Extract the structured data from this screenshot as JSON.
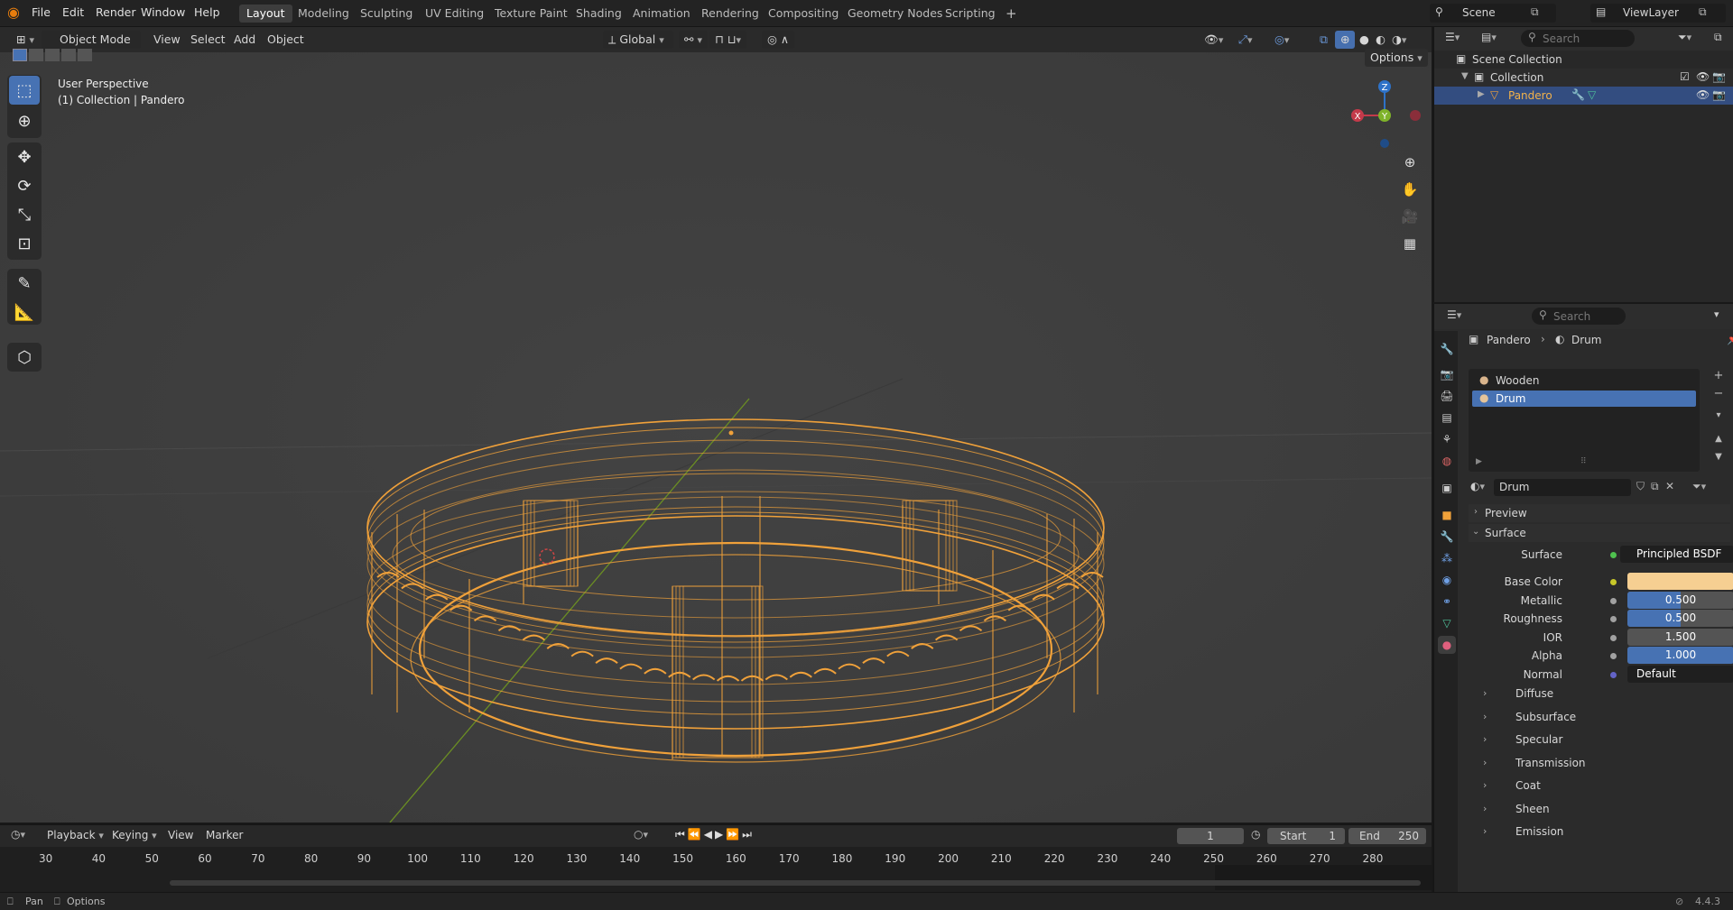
{
  "app": {
    "name": "Blender",
    "version": "4.4.3"
  },
  "menus": [
    "File",
    "Edit",
    "Render",
    "Window",
    "Help"
  ],
  "workspaces": [
    "Layout",
    "Modeling",
    "Sculpting",
    "UV Editing",
    "Texture Paint",
    "Shading",
    "Animation",
    "Rendering",
    "Compositing",
    "Geometry Nodes",
    "Scripting"
  ],
  "active_workspace": "Layout",
  "add_workspace": "+",
  "scene": {
    "label": "Scene",
    "viewlayer": "ViewLayer"
  },
  "viewport": {
    "mode": "Object Mode",
    "menus": [
      "View",
      "Select",
      "Add",
      "Object"
    ],
    "transform_orientation": "Global",
    "options_label": "Options",
    "info_line1": "User Perspective",
    "info_line2": "(1) Collection | Pandero",
    "gizmo": {
      "x": "X",
      "y": "Y",
      "z": "Z"
    },
    "wire_color": "#f0a13a"
  },
  "outliner": {
    "search_placeholder": "Search",
    "scene_collection": "Scene Collection",
    "collection": "Collection",
    "object": "Pandero"
  },
  "properties": {
    "search_placeholder": "Search",
    "breadcrumb_object": "Pandero",
    "breadcrumb_material": "Drum",
    "slots": [
      "Wooden",
      "Drum"
    ],
    "active_slot": "Drum",
    "material_name": "Drum",
    "panels": {
      "preview": "Preview",
      "surface": "Surface"
    },
    "surface_label": "Surface",
    "surface_shader": "Principled BSDF",
    "fields": [
      {
        "label": "Base Color",
        "value": "",
        "kind": "color",
        "color": "#f6cf92"
      },
      {
        "label": "Metallic",
        "value": "0.500",
        "kind": "slider",
        "fill": 0.5
      },
      {
        "label": "Roughness",
        "value": "0.500",
        "kind": "slider",
        "fill": 0.5
      },
      {
        "label": "IOR",
        "value": "1.500",
        "kind": "slider",
        "fill": 0
      },
      {
        "label": "Alpha",
        "value": "1.000",
        "kind": "slider",
        "fill": 1.0
      },
      {
        "label": "Normal",
        "value": "Default",
        "kind": "link"
      }
    ],
    "subpanels": [
      "Diffuse",
      "Subsurface",
      "Specular",
      "Transmission",
      "Coat",
      "Sheen",
      "Emission"
    ]
  },
  "timeline": {
    "menus": [
      "Playback",
      "Keying",
      "View",
      "Marker"
    ],
    "current_frame": "1",
    "start_label": "Start",
    "start_value": "1",
    "end_label": "End",
    "end_value": "250",
    "ticks": [
      "30",
      "40",
      "50",
      "60",
      "70",
      "80",
      "90",
      "100",
      "110",
      "120",
      "130",
      "140",
      "150",
      "160",
      "170",
      "180",
      "190",
      "200",
      "210",
      "220",
      "230",
      "240",
      "250",
      "260",
      "270",
      "280"
    ]
  },
  "status": {
    "pan": "Pan",
    "options": "Options",
    "version": "4.4.3"
  }
}
